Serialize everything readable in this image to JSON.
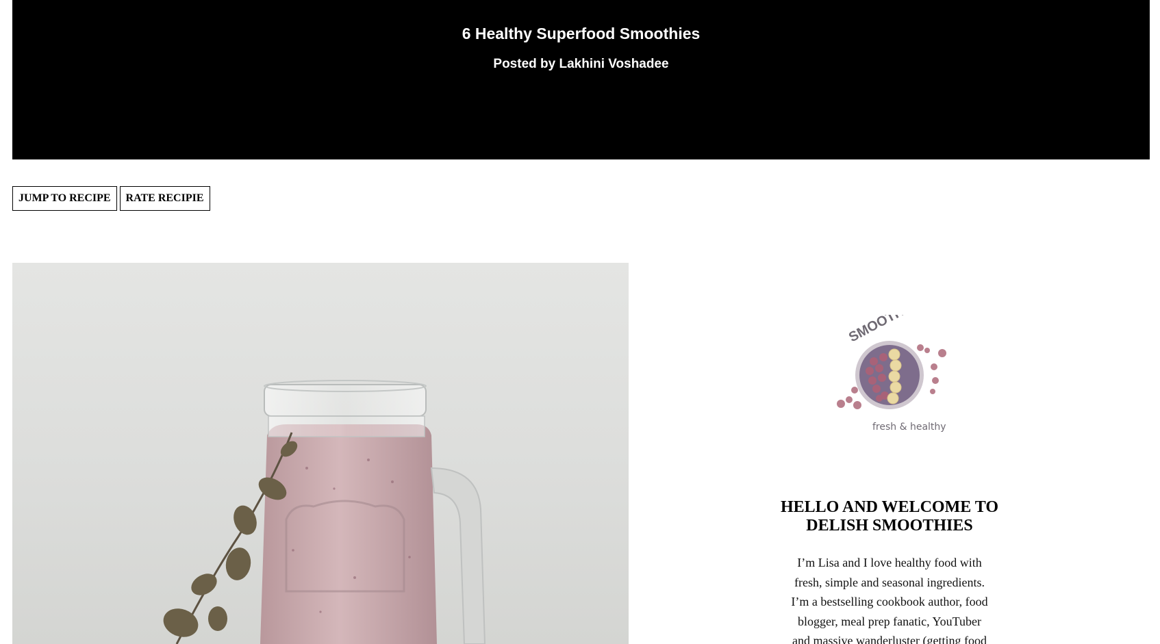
{
  "header": {
    "title": "6 Healthy Superfood Smoothies",
    "byline": "Posted by Lakhini Voshadee"
  },
  "actions": {
    "jump_label": "JUMP TO RECIPE",
    "rate_label": "RATE RECIPIE"
  },
  "logo": {
    "wordmark": "SMOOTHIE",
    "tagline": "fresh & healthy"
  },
  "sidebar": {
    "welcome_line1": "HELLO AND WELCOME TO",
    "welcome_line2": "DELISH SMOOTHIES",
    "bio_line1": "I’m Lisa and I love healthy food with",
    "bio_line2": "fresh, simple and seasonal ingredients.",
    "bio_line3": "I’m a bestselling cookbook author, food",
    "bio_line4": "blogger, meal prep fanatic, YouTuber",
    "bio_line5": "and massive wanderluster (getting food"
  },
  "colors": {
    "hero_bg": "#000000",
    "smoothie_pink": "#c9a9ad",
    "berry": "#7e6d8c",
    "banana": "#ead9a3",
    "dot_pink": "#b97f8d"
  }
}
